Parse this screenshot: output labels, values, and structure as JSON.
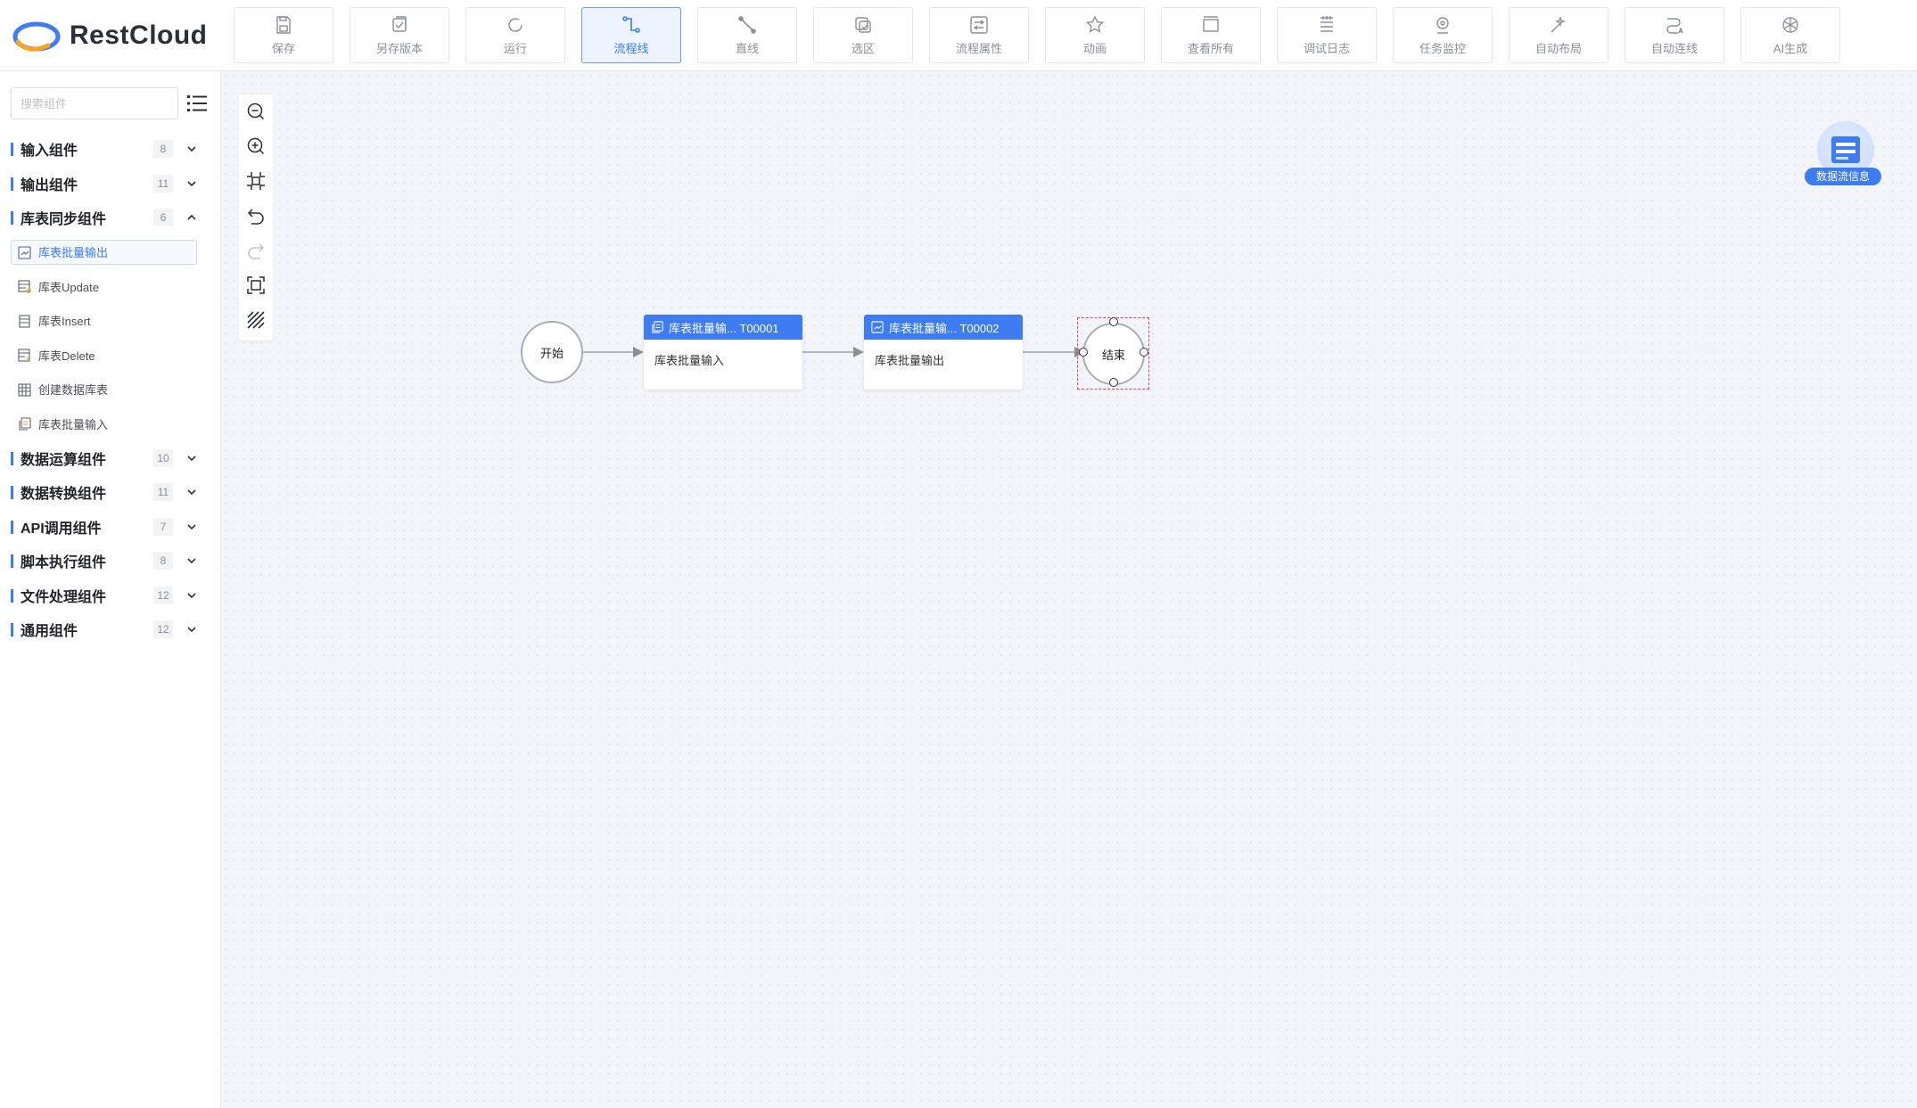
{
  "app": {
    "logo_text": "RestCloud"
  },
  "toolbar": {
    "items": [
      {
        "label": "保存",
        "icon": "save-icon"
      },
      {
        "label": "另存版本",
        "icon": "save-version-icon"
      },
      {
        "label": "运行",
        "icon": "run-icon"
      },
      {
        "label": "流程线",
        "icon": "flow-line-icon",
        "active": true
      },
      {
        "label": "直线",
        "icon": "straight-line-icon"
      },
      {
        "label": "选区",
        "icon": "selection-icon"
      },
      {
        "label": "流程属性",
        "icon": "properties-icon"
      },
      {
        "label": "动画",
        "icon": "animation-icon"
      },
      {
        "label": "查看所有",
        "icon": "view-all-icon"
      },
      {
        "label": "调试日志",
        "icon": "debug-log-icon"
      },
      {
        "label": "任务监控",
        "icon": "monitor-icon"
      },
      {
        "label": "自动布局",
        "icon": "auto-layout-icon"
      },
      {
        "label": "自动连线",
        "icon": "auto-connect-icon"
      },
      {
        "label": "AI生成",
        "icon": "ai-icon"
      }
    ]
  },
  "sidebar": {
    "search_placeholder": "搜索组件",
    "categories": [
      {
        "label": "输入组件",
        "count": "8",
        "expanded": false
      },
      {
        "label": "输出组件",
        "count": "11",
        "expanded": false
      },
      {
        "label": "库表同步组件",
        "count": "6",
        "expanded": true,
        "items": [
          {
            "label": "库表批量输出",
            "selected": true
          },
          {
            "label": "库表Update"
          },
          {
            "label": "库表Insert"
          },
          {
            "label": "库表Delete"
          },
          {
            "label": "创建数据库表"
          },
          {
            "label": "库表批量输入"
          }
        ]
      },
      {
        "label": "数据运算组件",
        "count": "10",
        "expanded": false
      },
      {
        "label": "数据转换组件",
        "count": "11",
        "expanded": false
      },
      {
        "label": "API调用组件",
        "count": "7",
        "expanded": false
      },
      {
        "label": "脚本执行组件",
        "count": "8",
        "expanded": false
      },
      {
        "label": "文件处理组件",
        "count": "12",
        "expanded": false
      },
      {
        "label": "通用组件",
        "count": "12",
        "expanded": false
      }
    ]
  },
  "canvas": {
    "dataflow_info_label": "数据流信息",
    "start_label": "开始",
    "end_label": "结束",
    "nodes": [
      {
        "title": "库表批量输... T00001",
        "body": "库表批量输入"
      },
      {
        "title": "库表批量输... T00002",
        "body": "库表批量输出"
      }
    ]
  },
  "colors": {
    "accent": "#3d7cf2",
    "selection": "#e24a4a",
    "canvas_bg": "#f3f5fa"
  }
}
